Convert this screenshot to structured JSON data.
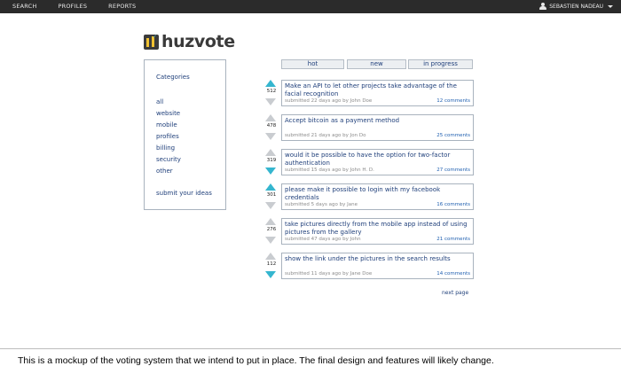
{
  "topbar": {
    "nav": [
      "SEARCH",
      "PROFILES",
      "REPORTS"
    ],
    "user_name": "SEBASTIEN NADEAU",
    "user_icon": "person-icon",
    "menu_icon": "caret-down-icon"
  },
  "logo": {
    "text": "huzvote"
  },
  "tabs": [
    "hot",
    "new",
    "in progress"
  ],
  "sidebar": {
    "title": "Categories",
    "categories": [
      "all",
      "website",
      "mobile",
      "profiles",
      "billing",
      "security",
      "other"
    ],
    "submit_label": "submit your ideas"
  },
  "ideas": [
    {
      "score": "512",
      "title": "Make an API to let other projects take advantage of the facial recognition",
      "meta": "submitted 22 days ago by John Doe",
      "comments": "12 comments",
      "vote": "up"
    },
    {
      "score": "478",
      "title": "Accept bitcoin as a payment method",
      "meta": "submitted 21 days ago by Jon Do",
      "comments": "25 comments",
      "vote": "none"
    },
    {
      "score": "319",
      "title": "would it be possible to have the option for two-factor authentication",
      "meta": "submitted 15 days ago by John H. D.",
      "comments": "27 comments",
      "vote": "down"
    },
    {
      "score": "301",
      "title": "please make it possible to login with my facebook credentials",
      "meta": "submitted 5 days ago by Jane",
      "comments": "16 comments",
      "vote": "up"
    },
    {
      "score": "276",
      "title": "take pictures directly from the mobile app instead of using pictures from the gallery",
      "meta": "submitted 47 days ago by John",
      "comments": "21 comments",
      "vote": "none"
    },
    {
      "score": "112",
      "title": "show the link under the pictures in the search results",
      "meta": "submitted 11 days ago by Jane Doe",
      "comments": "14 comments",
      "vote": "down"
    }
  ],
  "pagination": {
    "next_label": "next page"
  },
  "footer": {
    "note": "This is a mockup of the voting system that we intend to put in place.  The final design and features will likely change."
  },
  "colors": {
    "topbar": "#2b2b2b",
    "vote_active": "#35b6cf",
    "vote_inactive": "#c9ccd0",
    "link": "#1f3f7a"
  }
}
